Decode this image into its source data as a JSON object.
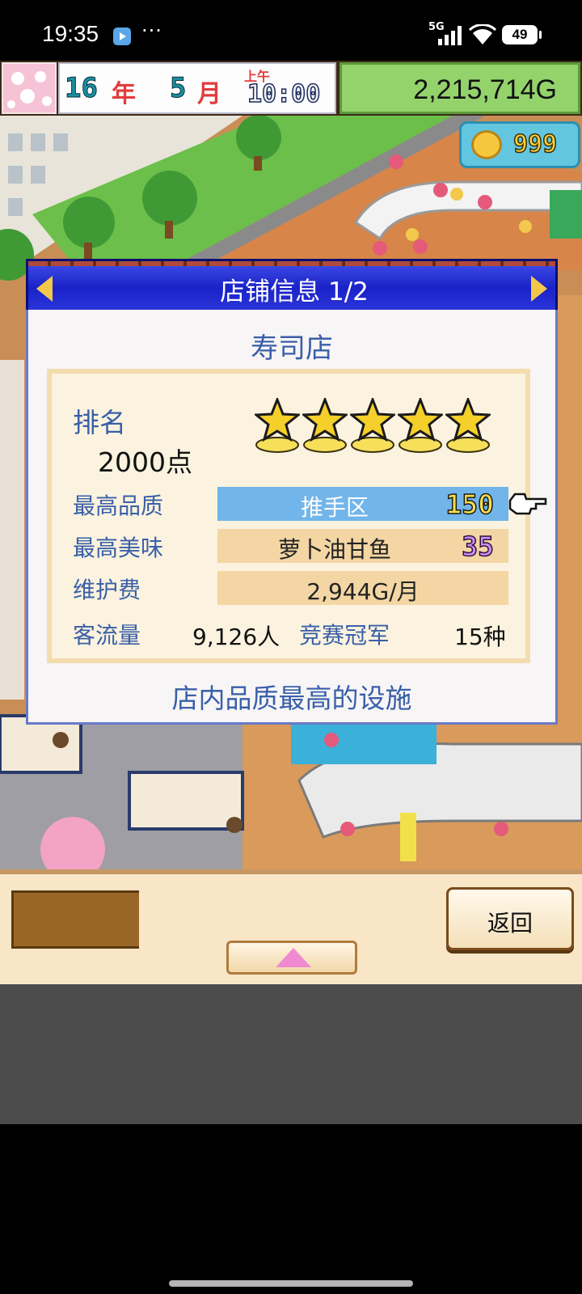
{
  "status_bar": {
    "time": "19:35",
    "more": "···",
    "network": "5G",
    "battery": "49",
    "icons": [
      "app-notification-icon",
      "signal-icon",
      "wifi-icon",
      "battery-icon"
    ]
  },
  "hud": {
    "year": "16",
    "year_unit": "年",
    "month": "5",
    "month_unit": "月",
    "ampm": "上午",
    "clock": "10:00",
    "money": "2,215,714G",
    "coins": "999"
  },
  "dialog": {
    "title": "店铺信息 1/2",
    "shop_name": "寿司店",
    "rank_label": "排名",
    "rank_value": "2000点",
    "rank_stars": 5,
    "quality_label": "最高品质",
    "quality_item": "推手区",
    "quality_value": "150",
    "taste_label": "最高美味",
    "taste_item": "萝卜油甘鱼",
    "taste_value": "35",
    "upkeep_label": "维护费",
    "upkeep_value": "2,944G/月",
    "traffic_label": "客流量",
    "traffic_value": "9,126人",
    "champion_label": "竞赛冠军",
    "champion_value": "15种",
    "hint": "店内品质最高的设施"
  },
  "bottom": {
    "back_label": "返回"
  },
  "colors": {
    "header_blue": "#1a22c8",
    "label_blue": "#3a5fa8",
    "money_green": "#94d36c",
    "star_yellow": "#f5cf2a"
  }
}
